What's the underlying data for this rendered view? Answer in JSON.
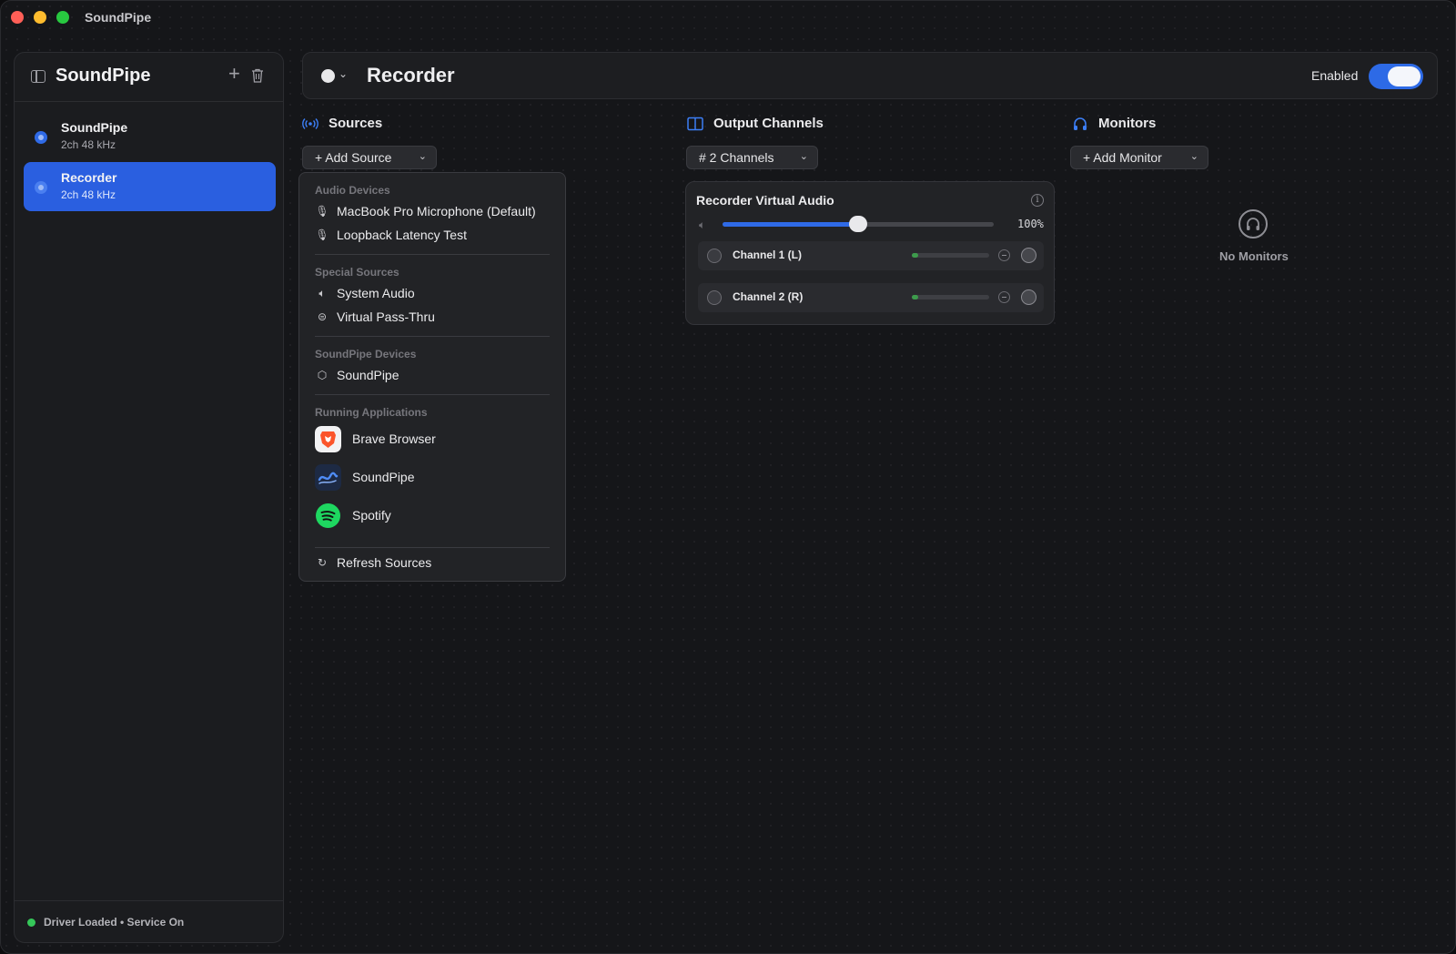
{
  "window": {
    "title": "SoundPipe"
  },
  "sidebar": {
    "title": "SoundPipe",
    "devices": [
      {
        "name": "SoundPipe",
        "meta": "2ch  48 kHz",
        "active": false
      },
      {
        "name": "Recorder",
        "meta": "2ch  48 kHz",
        "active": true
      }
    ],
    "status": "Driver Loaded • Service On"
  },
  "header": {
    "title": "Recorder",
    "enabled_label": "Enabled",
    "enabled": true
  },
  "sources": {
    "title": "Sources",
    "add_button": "+ Add Source",
    "menu": {
      "groups": {
        "audio_devices": "Audio Devices",
        "special_sources": "Special Sources",
        "soundpipe_devices": "SoundPipe Devices",
        "running_applications": "Running Applications"
      },
      "audio_devices": [
        "MacBook Pro Microphone (Default)",
        "Loopback Latency Test"
      ],
      "special_sources": [
        "System Audio",
        "Virtual Pass-Thru"
      ],
      "soundpipe_devices": [
        "SoundPipe"
      ],
      "running_applications": [
        "Brave Browser",
        "SoundPipe",
        "Spotify"
      ],
      "refresh": "Refresh Sources"
    }
  },
  "output": {
    "title": "Output Channels",
    "channels_button": "# 2 Channels",
    "card": {
      "title": "Recorder Virtual Audio",
      "volume_label": "100%",
      "volume_slider_fraction": 0.5,
      "channels": [
        {
          "name": "Channel 1 (L)",
          "level": 0.08
        },
        {
          "name": "Channel 2 (R)",
          "level": 0.08
        }
      ]
    }
  },
  "monitors": {
    "title": "Monitors",
    "add_button": "+ Add Monitor",
    "empty_label": "No Monitors"
  },
  "colors": {
    "accent": "#2f6ae6",
    "status_ok": "#35c759",
    "brave": "#fb542b",
    "spotify": "#1ed760"
  }
}
